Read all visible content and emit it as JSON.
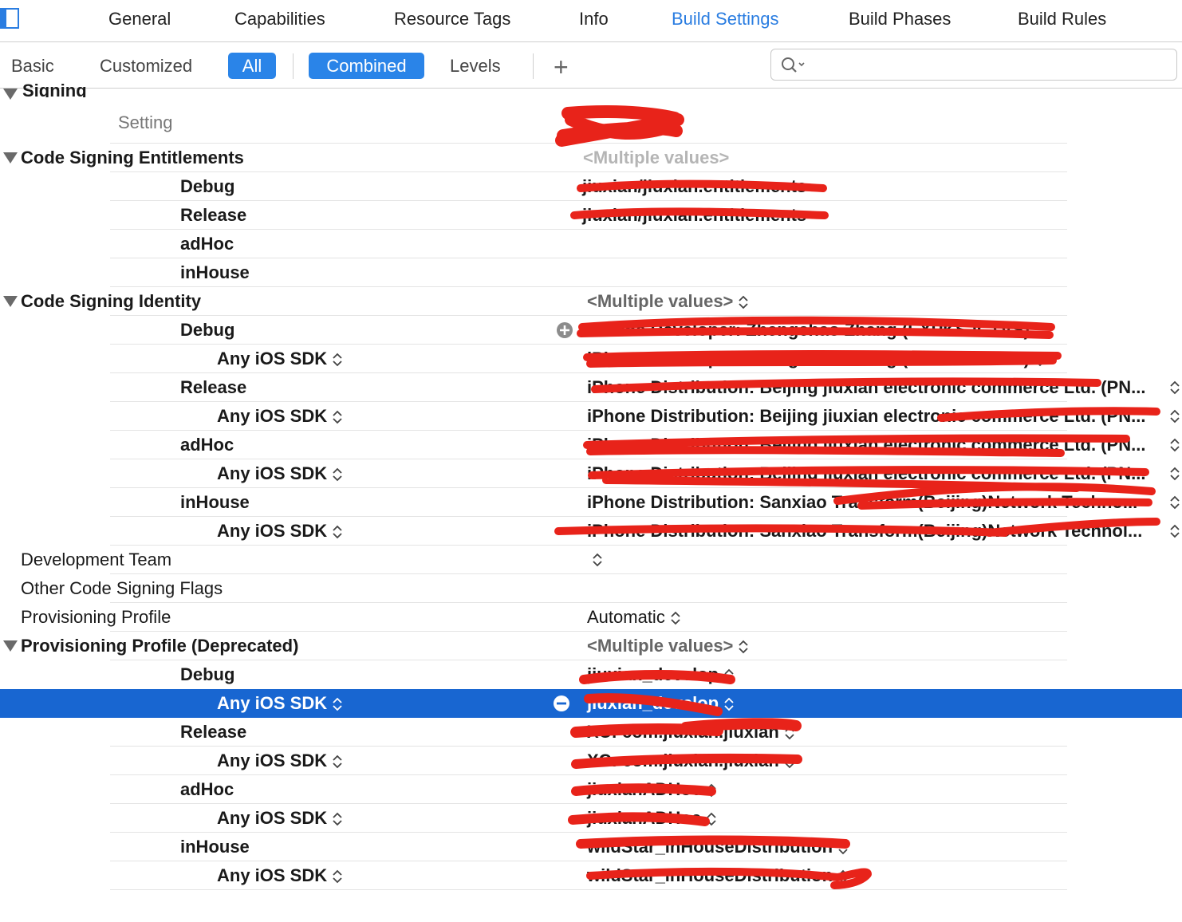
{
  "tabs": [
    {
      "label": "General",
      "active": false
    },
    {
      "label": "Capabilities",
      "active": false
    },
    {
      "label": "Resource Tags",
      "active": false
    },
    {
      "label": "Info",
      "active": false
    },
    {
      "label": "Build Settings",
      "active": true
    },
    {
      "label": "Build Phases",
      "active": false
    },
    {
      "label": "Build Rules",
      "active": false
    }
  ],
  "filters": {
    "basic": "Basic",
    "customized": "Customized",
    "all": "All",
    "combined": "Combined",
    "levels": "Levels",
    "add": "+",
    "search_placeholder": ""
  },
  "section": {
    "title": "Signing",
    "setting_header": "Setting"
  },
  "rows": {
    "cse": {
      "label": "Code Signing Entitlements",
      "value": "<Multiple values>"
    },
    "cse_debug": {
      "label": "Debug",
      "value": "jiuxian/jiuxian.entitlements"
    },
    "cse_release": {
      "label": "Release",
      "value": "jiuxian/jiuxian.entitlements"
    },
    "cse_adhoc": {
      "label": "adHoc",
      "value": ""
    },
    "cse_inhouse": {
      "label": "inHouse",
      "value": ""
    },
    "csi": {
      "label": "Code Signing Identity",
      "value": "<Multiple values>"
    },
    "csi_debug": {
      "label": "Debug",
      "value": "iPhone Developer: Zhengchao Zhang (EXPKSJCTVS)"
    },
    "csi_debug_sdk": {
      "label": "Any iOS SDK",
      "value": "iPhone Developer: Zhengchao Zhang (EXPKSJCTVS)"
    },
    "csi_release": {
      "label": "Release",
      "value": "iPhone Distribution: Beijing jiuxian electronic commerce Ltd. (PN..."
    },
    "csi_release_sdk": {
      "label": "Any iOS SDK",
      "value": "iPhone Distribution: Beijing jiuxian electronic commerce Ltd. (PN..."
    },
    "csi_adhoc": {
      "label": "adHoc",
      "value": "iPhone Distribution: Beijing jiuxian electronic commerce Ltd. (PN..."
    },
    "csi_adhoc_sdk": {
      "label": "Any iOS SDK",
      "value": "iPhone Distribution: Beijing jiuxian electronic commerce Ltd. (PN..."
    },
    "csi_inhouse": {
      "label": "inHouse",
      "value": "iPhone Distribution: Sanxiao Transform(Beijing)Network Techno..."
    },
    "csi_inhouse_sdk": {
      "label": "Any iOS SDK",
      "value": "iPhone Distribution: Sanxiao Transform(Beijing)Network Technol..."
    },
    "dev_team": {
      "label": "Development Team",
      "value": ""
    },
    "other_flags": {
      "label": "Other Code Signing Flags",
      "value": ""
    },
    "prov_profile": {
      "label": "Provisioning Profile",
      "value": "Automatic"
    },
    "ppd": {
      "label": "Provisioning Profile (Deprecated)",
      "value": "<Multiple values>"
    },
    "ppd_debug": {
      "label": "Debug",
      "value": "jiuxian_develop"
    },
    "ppd_debug_sdk": {
      "label": "Any iOS SDK",
      "value": "jiuxian_develop"
    },
    "ppd_release": {
      "label": "Release",
      "value": "XC: com.jiuxian.jiuxian"
    },
    "ppd_release_sdk": {
      "label": "Any iOS SDK",
      "value": "XC: com.jiuxian.jiuxian"
    },
    "ppd_adhoc": {
      "label": "adHoc",
      "value": "jiuxianADHoc"
    },
    "ppd_adhoc_sdk": {
      "label": "Any iOS SDK",
      "value": "jiuxianADHoc"
    },
    "ppd_inhouse": {
      "label": "inHouse",
      "value": "wildStar_inHouseDistribution"
    },
    "ppd_inhouse_sdk": {
      "label": "Any iOS SDK",
      "value": "wildStar_inHouseDistribution"
    }
  },
  "colors": {
    "accent": "#2a84e8",
    "selection": "#1866d1",
    "redaction": "#e8231a"
  }
}
